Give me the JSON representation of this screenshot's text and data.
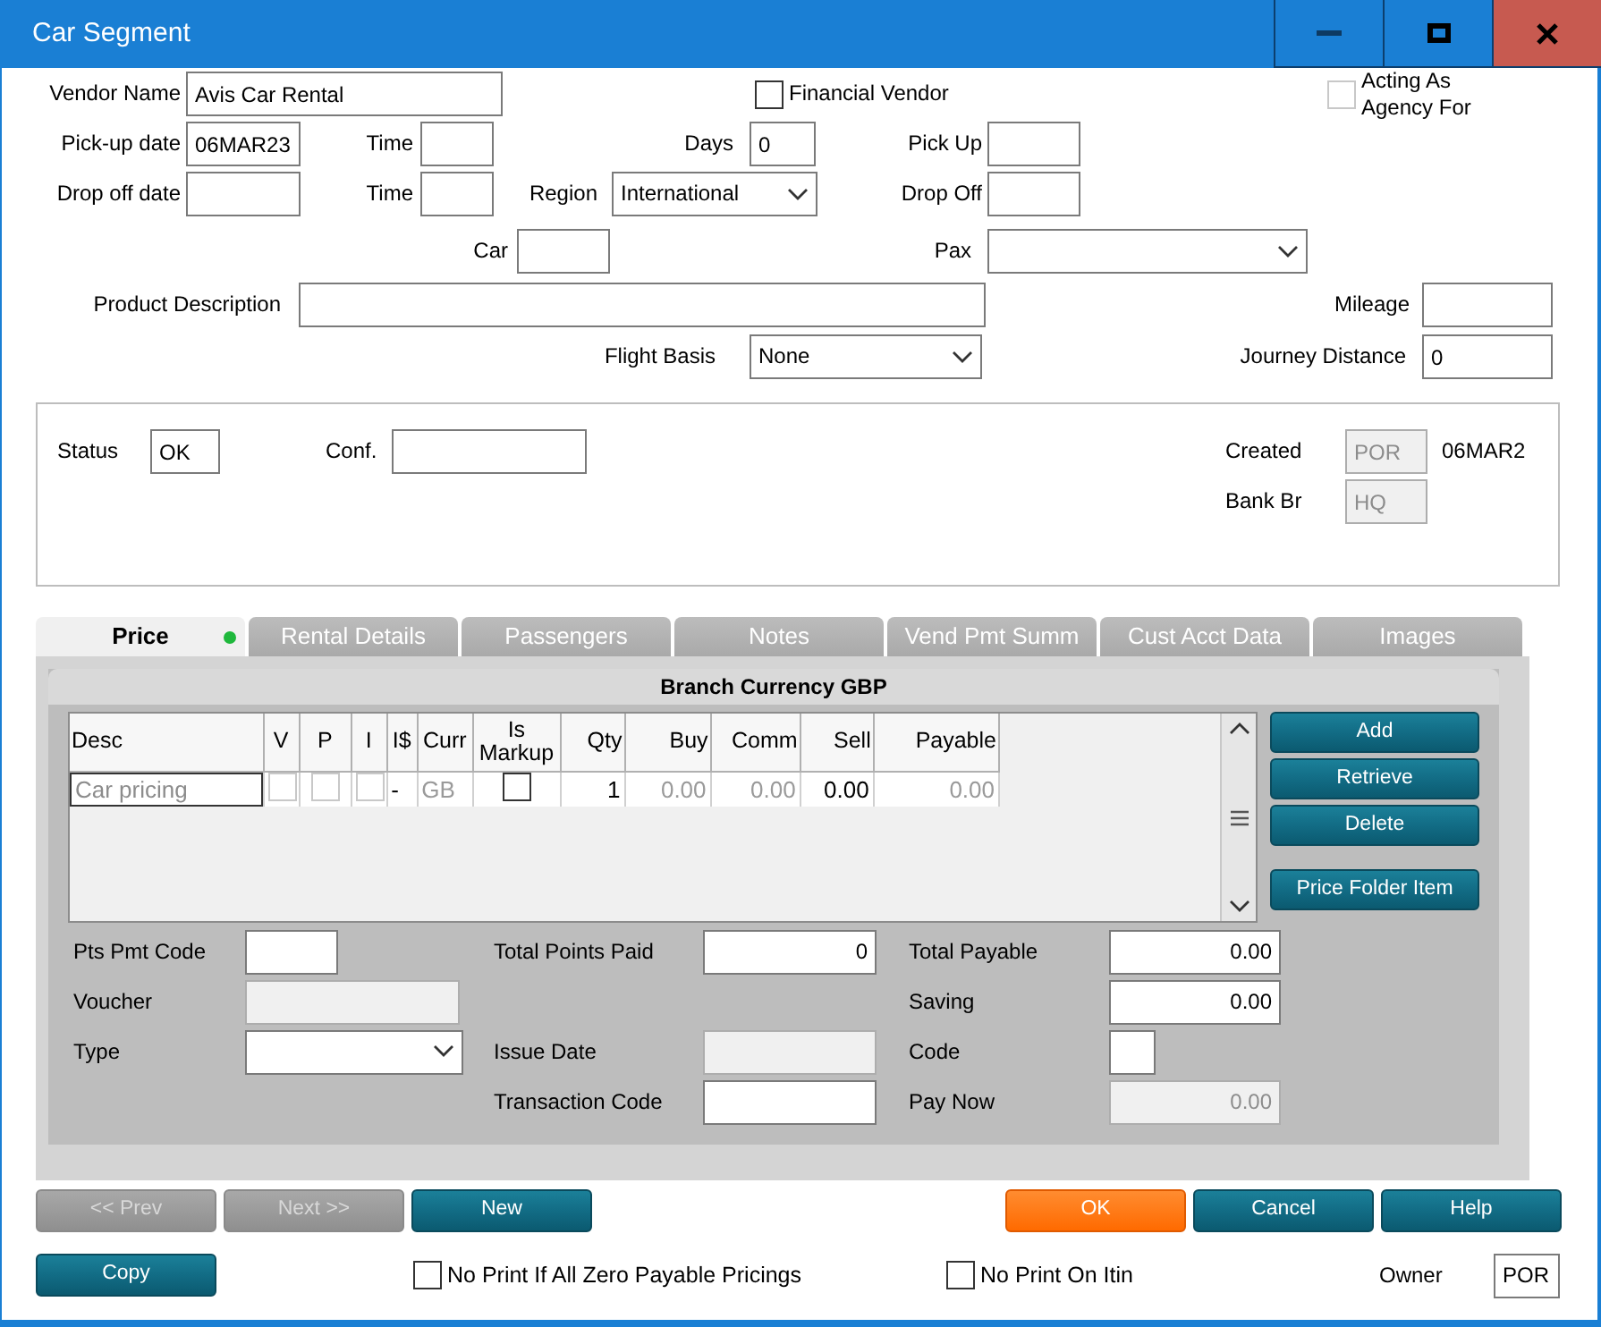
{
  "window": {
    "title": "Car Segment"
  },
  "header_rows": [
    [
      {
        "kind": "field",
        "label": "Vendor Name",
        "value": "Avis Car Rental"
      },
      {
        "kind": "check",
        "label": "Financial Vendor",
        "checked": false,
        "disabled": false
      },
      {
        "kind": "check",
        "label": "Acting As Agency For",
        "checked": false,
        "disabled": true
      }
    ],
    [
      {
        "kind": "field",
        "label": "Pick-up date",
        "value": "06MAR23"
      },
      {
        "kind": "field",
        "label": "Time"
      },
      {
        "kind": "field",
        "label": "Days",
        "value": "0"
      },
      {
        "kind": "field",
        "label": "Pick Up"
      }
    ],
    [
      {
        "kind": "field",
        "label": "Drop off date"
      },
      {
        "kind": "field",
        "label": "Time"
      },
      {
        "kind": "select",
        "label": "Region",
        "value": "International"
      },
      {
        "kind": "field",
        "label": "Drop Off"
      }
    ],
    [
      {
        "kind": "field",
        "label": "Car"
      },
      {
        "kind": "select",
        "label": "Pax"
      }
    ],
    [
      {
        "kind": "field",
        "label": "Product Description"
      },
      {
        "kind": "field",
        "label": "Mileage"
      }
    ],
    [
      {
        "kind": "select",
        "label": "Flight Basis",
        "value": "None"
      },
      {
        "kind": "field",
        "label": "Journey Distance",
        "value": "0"
      }
    ]
  ],
  "status_panel": {
    "status": {
      "kind": "field",
      "label": "Status",
      "value": "OK",
      "disabled": false
    },
    "confirmation": {
      "kind": "field",
      "label": "Conf.",
      "disabled": false
    },
    "created": {
      "kind": "field",
      "label": "Created",
      "value": "POR",
      "disabled": true
    },
    "created_date": {
      "kind": "text",
      "value": "06MAR2"
    },
    "bank_branch": {
      "kind": "field",
      "label": "Bank Br",
      "value": "HQ",
      "disabled": true
    }
  },
  "tabs": [
    {
      "label": "Price",
      "selected": true,
      "indicator": true
    },
    {
      "label": "Rental Details",
      "selected": false,
      "indicator": false
    },
    {
      "label": "Passengers",
      "selected": false,
      "indicator": false
    },
    {
      "label": "Notes",
      "selected": false,
      "indicator": false
    },
    {
      "label": "Vend Pmt Summ",
      "selected": false,
      "indicator": false
    },
    {
      "label": "Cust Acct Data",
      "selected": false,
      "indicator": false
    },
    {
      "label": "Images",
      "selected": false,
      "indicator": false
    }
  ],
  "price_panel": {
    "title": "Branch Currency GBP",
    "grid": {
      "columns": [
        "Desc",
        "V",
        "P",
        "I",
        "I$",
        "Curr",
        "Is Markup",
        "Qty",
        "Buy",
        "Comm",
        "Sell",
        "Payable"
      ],
      "rows": [
        {
          "cells": [
            {
              "kind": "input",
              "value": "Car pricing"
            },
            {
              "kind": "check",
              "checked": false,
              "disabled": true
            },
            {
              "kind": "check",
              "checked": false,
              "disabled": true
            },
            {
              "kind": "check",
              "checked": false,
              "disabled": true
            },
            {
              "kind": "text",
              "value": "-",
              "muted": false
            },
            {
              "kind": "text",
              "value": "GB",
              "muted": true
            },
            {
              "kind": "check",
              "checked": false,
              "disabled": false
            },
            {
              "kind": "number",
              "value": "1",
              "muted": false
            },
            {
              "kind": "number",
              "value": "0.00",
              "muted": true
            },
            {
              "kind": "number",
              "value": "0.00",
              "muted": true
            },
            {
              "kind": "number",
              "value": "0.00",
              "muted": false
            },
            {
              "kind": "number",
              "value": "0.00",
              "muted": true
            }
          ]
        }
      ]
    },
    "side_buttons": [
      "Add",
      "Retrieve",
      "Delete",
      "Price Folder Item"
    ],
    "fields": [
      [
        {
          "kind": "field",
          "label": "Pts Pmt Code",
          "disabled": false
        },
        {
          "kind": "number",
          "label": "Total Points Paid",
          "value": "0",
          "disabled": false
        },
        {
          "kind": "number",
          "label": "Total Payable",
          "value": "0.00",
          "disabled": false
        }
      ],
      [
        {
          "kind": "field",
          "label": "Voucher",
          "disabled": true
        },
        {
          "kind": "number",
          "label": "Saving",
          "value": "0.00",
          "disabled": false
        }
      ],
      [
        {
          "kind": "select",
          "label": "Type"
        },
        {
          "kind": "field",
          "label": "Issue Date",
          "disabled": true
        },
        {
          "kind": "field",
          "label": "Code",
          "disabled": false
        }
      ],
      [
        {
          "kind": "field",
          "label": "Transaction Code",
          "disabled": false
        },
        {
          "kind": "number",
          "label": "Pay Now",
          "value": "0.00",
          "disabled": true
        }
      ]
    ]
  },
  "nav_buttons": [
    {
      "label": "<< Prev",
      "kind": "standard",
      "disabled": true
    },
    {
      "label": "Next >>",
      "kind": "standard",
      "disabled": true
    },
    {
      "label": "New",
      "kind": "standard",
      "disabled": false
    },
    {
      "label": "OK",
      "kind": "primary",
      "disabled": false
    },
    {
      "label": "Cancel",
      "kind": "standard",
      "disabled": false
    },
    {
      "label": "Help",
      "kind": "standard",
      "disabled": false
    }
  ],
  "footer": {
    "copy_button": "Copy",
    "options": [
      {
        "label": "No Print If All Zero Payable Pricings",
        "checked": false
      },
      {
        "label": "No Print On Itin",
        "checked": false
      }
    ],
    "owner": {
      "label": "Owner",
      "value": "POR"
    }
  }
}
